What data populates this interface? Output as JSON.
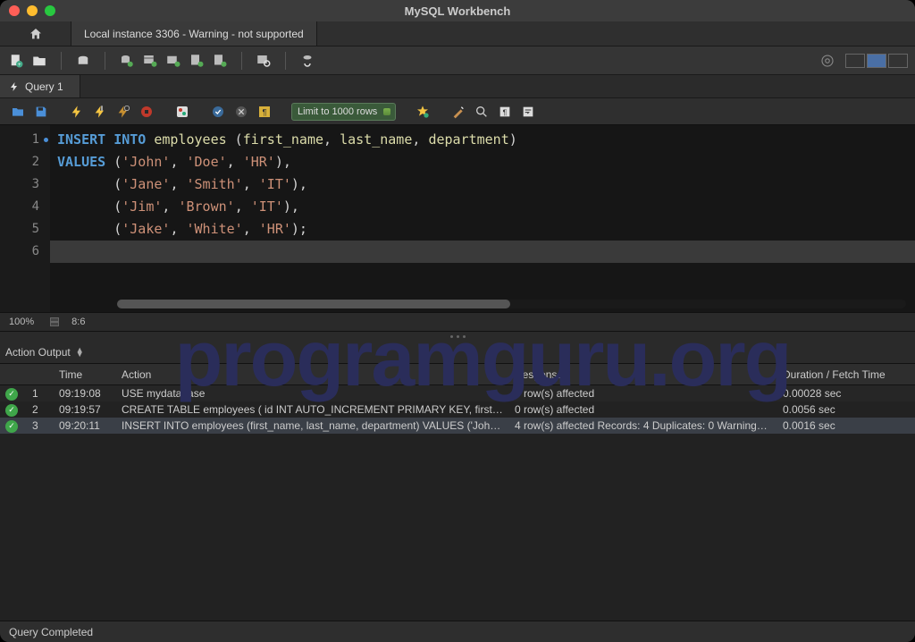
{
  "title": "MySQL Workbench",
  "conn_tab": "Local instance 3306 - Warning - not supported",
  "query_tab": "Query 1",
  "limit_label": "Limit to 1000 rows",
  "editor": {
    "lines": [
      {
        "n": "1",
        "marked": true,
        "segs": [
          [
            "kw",
            "INSERT"
          ],
          [
            "pn",
            " "
          ],
          [
            "kw",
            "INTO"
          ],
          [
            "pn",
            " "
          ],
          [
            "id",
            "employees"
          ],
          [
            "pn",
            " ("
          ],
          [
            "id",
            "first_name"
          ],
          [
            "pn",
            ", "
          ],
          [
            "id",
            "last_name"
          ],
          [
            "pn",
            ", "
          ],
          [
            "id",
            "department"
          ],
          [
            "pn",
            ")"
          ]
        ]
      },
      {
        "n": "2",
        "segs": [
          [
            "kw",
            "VALUES"
          ],
          [
            "pn",
            " ("
          ],
          [
            "str",
            "'John'"
          ],
          [
            "pn",
            ", "
          ],
          [
            "str",
            "'Doe'"
          ],
          [
            "pn",
            ", "
          ],
          [
            "str",
            "'HR'"
          ],
          [
            "pn",
            "),"
          ]
        ]
      },
      {
        "n": "3",
        "segs": [
          [
            "pn",
            "       ("
          ],
          [
            "str",
            "'Jane'"
          ],
          [
            "pn",
            ", "
          ],
          [
            "str",
            "'Smith'"
          ],
          [
            "pn",
            ", "
          ],
          [
            "str",
            "'IT'"
          ],
          [
            "pn",
            "),"
          ]
        ]
      },
      {
        "n": "4",
        "segs": [
          [
            "pn",
            "       ("
          ],
          [
            "str",
            "'Jim'"
          ],
          [
            "pn",
            ", "
          ],
          [
            "str",
            "'Brown'"
          ],
          [
            "pn",
            ", "
          ],
          [
            "str",
            "'IT'"
          ],
          [
            "pn",
            "),"
          ]
        ]
      },
      {
        "n": "5",
        "segs": [
          [
            "pn",
            "       ("
          ],
          [
            "str",
            "'Jake'"
          ],
          [
            "pn",
            ", "
          ],
          [
            "str",
            "'White'"
          ],
          [
            "pn",
            ", "
          ],
          [
            "str",
            "'HR'"
          ],
          [
            "pn",
            ");"
          ]
        ]
      },
      {
        "n": "6",
        "current": true,
        "segs": []
      }
    ],
    "zoom": "100%",
    "cursor": "8:6"
  },
  "watermark": "programguru.org",
  "output": {
    "selector": "Action Output",
    "headers": {
      "time": "Time",
      "action": "Action",
      "response": "Response",
      "duration": "Duration / Fetch Time"
    },
    "rows": [
      {
        "idx": "1",
        "time": "09:19:08",
        "action": "USE mydatabase",
        "response": "0 row(s) affected",
        "duration": "0.00028 sec"
      },
      {
        "idx": "2",
        "time": "09:19:57",
        "action": "CREATE TABLE employees (     id INT AUTO_INCREMENT PRIMARY KEY,     first_n…",
        "response": "0 row(s) affected",
        "duration": "0.0056 sec"
      },
      {
        "idx": "3",
        "time": "09:20:11",
        "action": "INSERT INTO employees (first_name, last_name, department) VALUES ('John', 'D…",
        "response": "4 row(s) affected Records: 4  Duplicates: 0  Warnings…",
        "duration": "0.0016 sec",
        "selected": true
      }
    ]
  },
  "footer_status": "Query Completed"
}
